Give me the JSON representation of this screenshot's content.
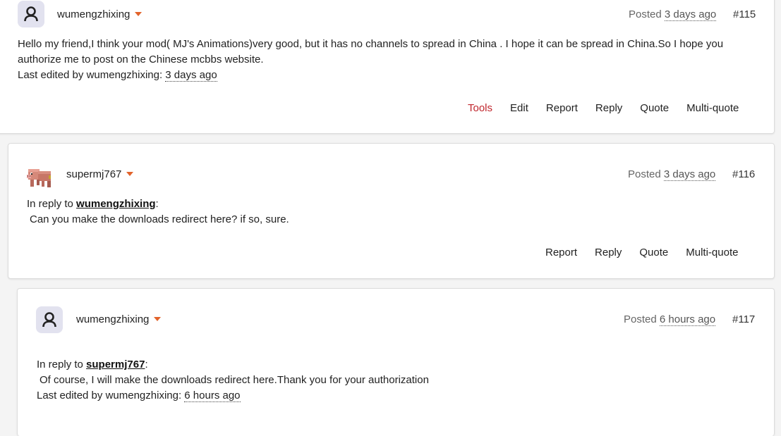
{
  "posts": [
    {
      "username": "wumengzhixing",
      "posted_label": "Posted",
      "time": "3 days ago",
      "number": "#115",
      "body_lines": [
        "Hello my friend,I think your mod( MJ's Animations)very good, but it has no channels to spread in China . I hope it can be spread in China.So I hope you",
        "authorize me to post on the Chinese mcbbs website."
      ],
      "edited_label": "Last edited by wumengzhixing:",
      "edited_time": "3 days ago",
      "actions": [
        "Tools",
        "Edit",
        "Report",
        "Reply",
        "Quote",
        "Multi-quote"
      ],
      "avatar_icon": "user-icon"
    },
    {
      "username": "supermj767",
      "posted_label": "Posted",
      "time": "3 days ago",
      "number": "#116",
      "reply_prefix": "In reply to",
      "reply_to": "wumengzhixing",
      "reply_suffix": ":",
      "body_line": "Can you make the downloads redirect here? if so, sure.",
      "actions": [
        "Report",
        "Reply",
        "Quote",
        "Multi-quote"
      ],
      "avatar_icon": "pig-avatar-icon"
    },
    {
      "username": "wumengzhixing",
      "posted_label": "Posted",
      "time": "6 hours ago",
      "number": "#117",
      "reply_prefix": "In reply to",
      "reply_to": "supermj767",
      "reply_suffix": ":",
      "body_line": "Of course, I will make the downloads redirect here.Thank you for your authorization",
      "edited_label": "Last edited by wumengzhixing:",
      "edited_time": "6 hours ago",
      "avatar_icon": "user-icon"
    }
  ],
  "colors": {
    "accent_caret": "#e2632b",
    "tools_link": "#c0262d",
    "avatar_bg": "#e2e2ef"
  }
}
